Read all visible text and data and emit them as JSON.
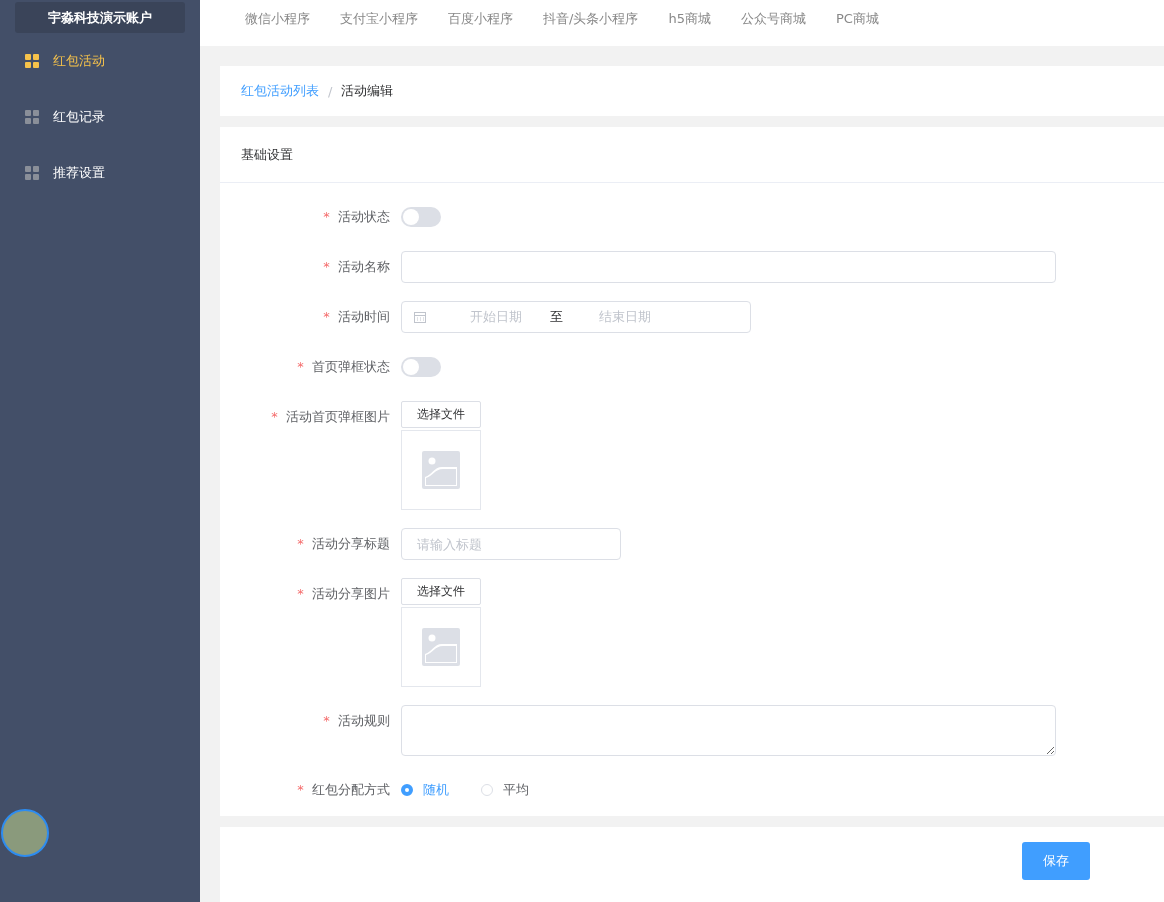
{
  "account": "宇淼科技演示账户",
  "sidebar": {
    "items": [
      {
        "label": "红包活动",
        "selected": true
      },
      {
        "label": "红包记录",
        "selected": false
      },
      {
        "label": "推荐设置",
        "selected": false
      }
    ]
  },
  "top_nav": [
    "微信小程序",
    "支付宝小程序",
    "百度小程序",
    "抖音/头条小程序",
    "h5商城",
    "公众号商城",
    "PC商城"
  ],
  "breadcrumb_separator": "/",
  "required_mark": "*",
  "breadcrumb": [
    {
      "label": "红包活动列表",
      "kind": "link"
    },
    {
      "label": "活动编辑",
      "kind": "current"
    }
  ],
  "section_title": "基础设置",
  "fields": [
    {
      "kind": "switch",
      "label": "活动状态",
      "required": true,
      "on": false
    },
    {
      "kind": "text",
      "label": "活动名称",
      "required": true
    },
    {
      "kind": "daterange",
      "label": "活动时间",
      "required": true,
      "start_placeholder": "开始日期",
      "separator": "至",
      "end_placeholder": "结束日期"
    },
    {
      "kind": "switch",
      "label": "首页弹框状态",
      "required": true,
      "on": false
    },
    {
      "kind": "file",
      "label": "活动首页弹框图片",
      "required": true,
      "button": "选择文件"
    },
    {
      "kind": "short_text",
      "label": "活动分享标题",
      "required": true,
      "placeholder": "请输入标题"
    },
    {
      "kind": "file",
      "label": "活动分享图片",
      "required": true,
      "button": "选择文件"
    },
    {
      "kind": "textarea",
      "label": "活动规则",
      "required": true
    },
    {
      "kind": "radio",
      "label": "红包分配方式",
      "required": true,
      "options": [
        {
          "label": "随机",
          "selected": true
        },
        {
          "label": "平均",
          "selected": false
        }
      ]
    }
  ],
  "save_button": "保存"
}
